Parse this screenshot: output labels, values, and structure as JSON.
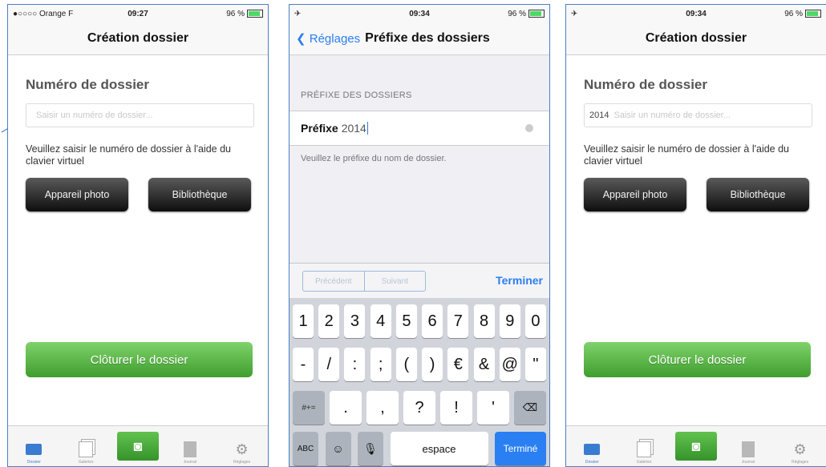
{
  "phone1": {
    "status": {
      "carrier": "●○○○○ Orange F",
      "time": "09:27",
      "battery": "96 %"
    },
    "title": "Création dossier",
    "field_label": "Numéro de dossier",
    "field_prefix": "",
    "field_placeholder": "Saisir un numéro de dossier...",
    "hint": "Veuillez saisir le numéro de dossier à l'aide du clavier virtuel",
    "btn_camera": "Appareil photo",
    "btn_library": "Bibliothèque",
    "btn_close": "Clôturer le dossier",
    "tabs": [
      "Dossier",
      "Galeries",
      "",
      "Journal",
      "Réglages"
    ]
  },
  "phone2": {
    "status": {
      "time": "09:34",
      "battery": "96 %"
    },
    "back_label": "Réglages",
    "title": "Préfixe des dossiers",
    "section_header": "PRÉFIXE DES DOSSIERS",
    "cell_label": "Préfixe",
    "cell_value": "2014",
    "footer": "Veuillez le préfixe du nom de dossier.",
    "prev_label": "Précédent",
    "next_label": "Suivant",
    "done_label": "Terminer",
    "keys_row1": [
      "1",
      "2",
      "3",
      "4",
      "5",
      "6",
      "7",
      "8",
      "9",
      "0"
    ],
    "keys_row2": [
      "-",
      "/",
      ":",
      ";",
      "(",
      ")",
      "€",
      "&",
      "@",
      "\""
    ],
    "keys_row3_left": "#+=",
    "keys_row3": [
      ".",
      ",",
      "?",
      "!",
      "'"
    ],
    "keys_row3_right": "⌫",
    "key_abc": "ABC",
    "key_emoji": "☺",
    "key_mic": "🎙",
    "key_space": "espace",
    "key_return": "Terminé"
  },
  "phone3": {
    "status": {
      "time": "09:34",
      "battery": "96 %"
    },
    "title": "Création dossier",
    "field_label": "Numéro de dossier",
    "field_prefix": "2014",
    "field_placeholder": "Saisir un numéro de dossier...",
    "hint": "Veuillez saisir le numéro de dossier à l'aide du clavier virtuel",
    "btn_camera": "Appareil photo",
    "btn_library": "Bibliothèque",
    "btn_close": "Clôturer le dossier",
    "tabs": [
      "Dossier",
      "Galeries",
      "",
      "Journal",
      "Réglages"
    ]
  },
  "colors": {
    "accent": "#2a7ff2",
    "green": "#4cae3a",
    "frame": "#4a7fc1"
  }
}
